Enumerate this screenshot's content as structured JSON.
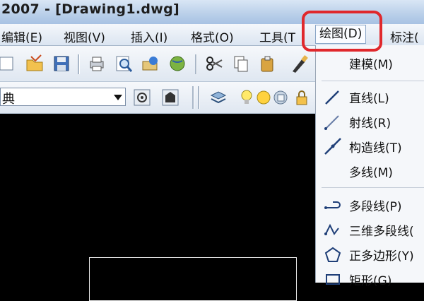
{
  "title": "2007 - [Drawing1.dwg]",
  "menubar": {
    "items": [
      "编辑(E)",
      "视图(V)",
      "插入(I)",
      "格式(O)",
      "工具(T",
      "绘图(D)",
      "标注("
    ],
    "active_index": 5
  },
  "toolbar2": {
    "style_dropdown_value": "典"
  },
  "draw_menu": {
    "items": [
      {
        "label": "建模(M)",
        "icon": ""
      },
      {
        "label": "直线(L)",
        "icon": "line-icon"
      },
      {
        "label": "射线(R)",
        "icon": "ray-icon"
      },
      {
        "label": "构造线(T)",
        "icon": "construction-line-icon"
      },
      {
        "label": "多线(M)",
        "icon": ""
      },
      {
        "label": "多段线(P)",
        "icon": "polyline-icon"
      },
      {
        "label": "三维多段线(",
        "icon": "3d-polyline-icon"
      },
      {
        "label": "正多边形(Y)",
        "icon": "polygon-icon"
      },
      {
        "label": "矩形(G)",
        "icon": "rectangle-icon"
      }
    ]
  },
  "colors": {
    "highlight_ring": "#e0282c",
    "canvas": "#000000",
    "menu_bg": "#f5f7fa"
  }
}
